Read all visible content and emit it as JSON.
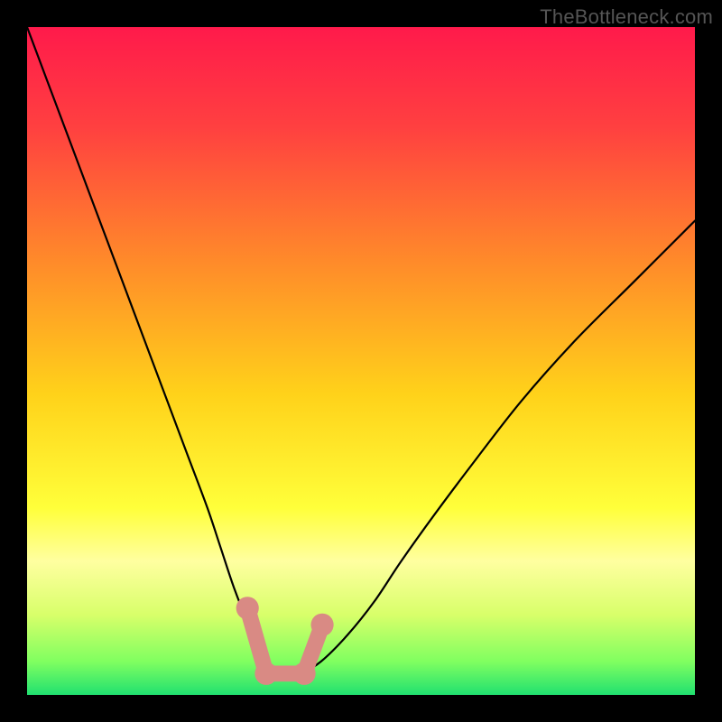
{
  "watermark": "TheBottleneck.com",
  "chart_data": {
    "type": "line",
    "title": "",
    "xlabel": "",
    "ylabel": "",
    "xlim": [
      0,
      100
    ],
    "ylim": [
      0,
      100
    ],
    "grid": false,
    "legend": false,
    "background_gradient": {
      "stops": [
        {
          "offset": 0.0,
          "color": "#ff1a4b"
        },
        {
          "offset": 0.15,
          "color": "#ff4040"
        },
        {
          "offset": 0.35,
          "color": "#ff8a2a"
        },
        {
          "offset": 0.55,
          "color": "#ffd21a"
        },
        {
          "offset": 0.72,
          "color": "#ffff3a"
        },
        {
          "offset": 0.8,
          "color": "#ffffa0"
        },
        {
          "offset": 0.88,
          "color": "#d8ff6a"
        },
        {
          "offset": 0.95,
          "color": "#80ff60"
        },
        {
          "offset": 1.0,
          "color": "#20e070"
        }
      ]
    },
    "series": [
      {
        "name": "curve",
        "color": "#000000",
        "x": [
          0,
          3,
          6,
          9,
          12,
          15,
          18,
          21,
          24,
          27,
          29,
          31,
          33,
          35,
          36.5,
          38,
          39.5,
          41,
          44,
          48,
          52,
          56,
          61,
          67,
          74,
          82,
          91,
          100
        ],
        "y": [
          100,
          92,
          84,
          76,
          68,
          60,
          52,
          44,
          36,
          28,
          22,
          16,
          11,
          7,
          4.5,
          3,
          3,
          3.2,
          5,
          9,
          14,
          20,
          27,
          35,
          44,
          53,
          62,
          71
        ]
      }
    ],
    "valley_marker": {
      "color": "#d98a84",
      "cap_radius": 1.7,
      "stroke_width": 2.4,
      "left": {
        "top": {
          "x": 33.0,
          "y": 13.0
        },
        "bottom": {
          "x": 35.8,
          "y": 3.2
        }
      },
      "right": {
        "top": {
          "x": 44.2,
          "y": 10.5
        },
        "bottom": {
          "x": 41.5,
          "y": 3.2
        }
      },
      "base": {
        "from": {
          "x": 35.8,
          "y": 3.2
        },
        "to": {
          "x": 41.5,
          "y": 3.2
        }
      }
    }
  }
}
